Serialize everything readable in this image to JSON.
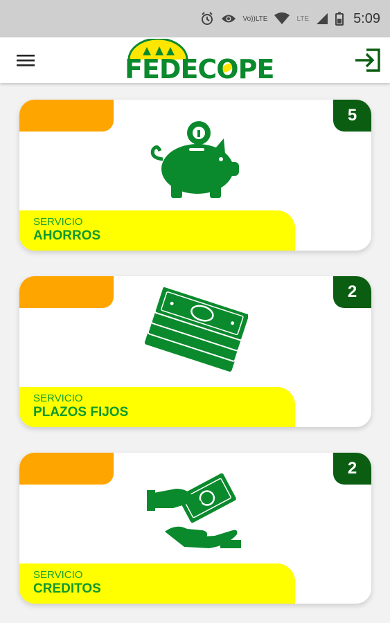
{
  "status_bar": {
    "time": "5:09",
    "volte_label_top": "Vo))",
    "volte_label_bottom": "LTE",
    "lte_label": "LTE",
    "icons": [
      "alarm-icon",
      "eye-icon",
      "volte-icon",
      "wifi-icon",
      "lte-icon",
      "signal-icon",
      "battery-icon"
    ]
  },
  "app_bar": {
    "logo_text": "FEDECOPE",
    "menu_icon": "hamburger-menu-icon",
    "login_icon": "login-icon"
  },
  "colors": {
    "green": "#0b8a2d",
    "dark_green": "#0b5d12",
    "yellow": "#ffff00",
    "orange": "#ffa500"
  },
  "cards": [
    {
      "prefix": "SERVICIO",
      "title": "AHORROS",
      "count": "5",
      "icon": "piggy-bank-icon"
    },
    {
      "prefix": "SERVICIO",
      "title": "PLAZOS FIJOS",
      "count": "2",
      "icon": "money-stack-icon"
    },
    {
      "prefix": "SERVICIO",
      "title": "CREDITOS",
      "count": "2",
      "icon": "money-hand-icon"
    }
  ]
}
